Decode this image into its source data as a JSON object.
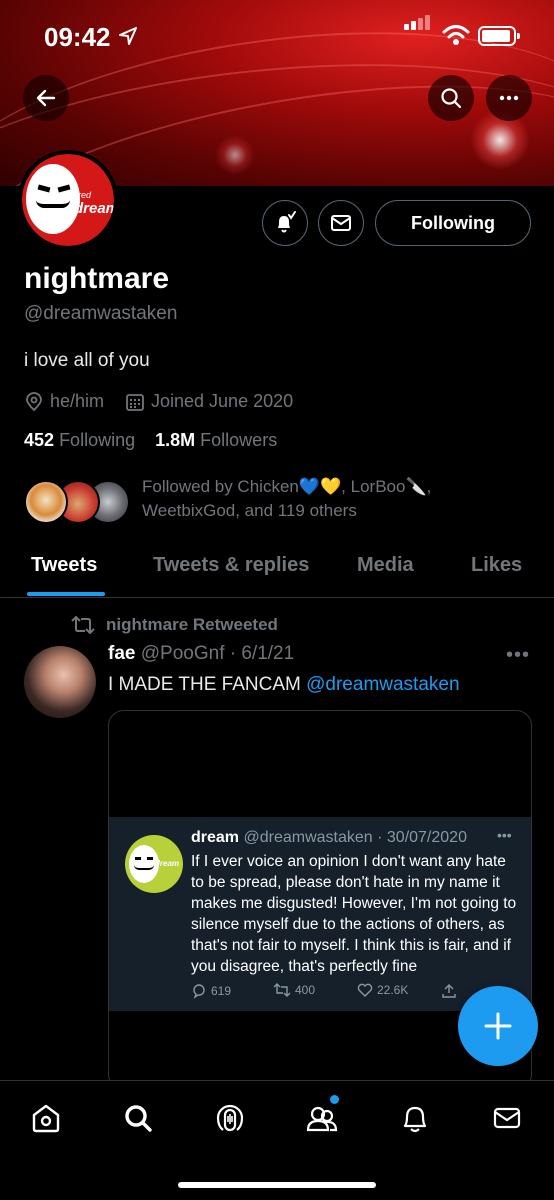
{
  "status_bar": {
    "time": "09:42"
  },
  "profile": {
    "avatar_text_small": "red",
    "avatar_text": "dream",
    "name": "nightmare",
    "handle": "@dreamwastaken",
    "bio": "i love all of you",
    "pronouns": "he/him",
    "joined": "Joined June 2020",
    "following_count": "452",
    "following_label": "Following",
    "followers_count": "1.8M",
    "followers_label": "Followers",
    "followed_by_line1": "Followed by Chicken💙💛, LorBoo🔪,",
    "followed_by_line2": "WeetbixGod, and 119 others",
    "follow_button_label": "Following"
  },
  "tabs": [
    {
      "label": "Tweets",
      "active": true
    },
    {
      "label": "Tweets & replies",
      "active": false
    },
    {
      "label": "Media",
      "active": false
    },
    {
      "label": "Likes",
      "active": false
    }
  ],
  "tweet": {
    "retweet_label": "nightmare Retweeted",
    "author_name": "fae",
    "author_meta": "@PooGnf · 6/1/21",
    "more": "•••",
    "text": "I MADE THE FANCAM ",
    "mention": "@dreamwastaken",
    "embedded": {
      "avatar_text": "dream",
      "name": "dream",
      "meta": "@dreamwastaken · 30/07/2020",
      "more": "•••",
      "text": "If I ever voice an opinion I don't want any hate to be spread, please don't hate in my name it makes me disgusted! However, I'm not going to silence myself due to the actions of others, as that's not fair to myself. I think this is fair, and if you disagree, that's perfectly fine",
      "replies": "619",
      "retweets": "400",
      "likes": "22.6K"
    }
  },
  "accent_color": "#1d9bf0",
  "icons": [
    "back-arrow-icon",
    "search-icon",
    "more-icon",
    "notification-bell-icon",
    "mail-icon",
    "location-icon",
    "calendar-icon",
    "retweet-icon",
    "compose-plus-icon",
    "home-icon",
    "explore-icon",
    "spaces-icon",
    "communities-icon",
    "bell-icon",
    "messages-icon"
  ]
}
